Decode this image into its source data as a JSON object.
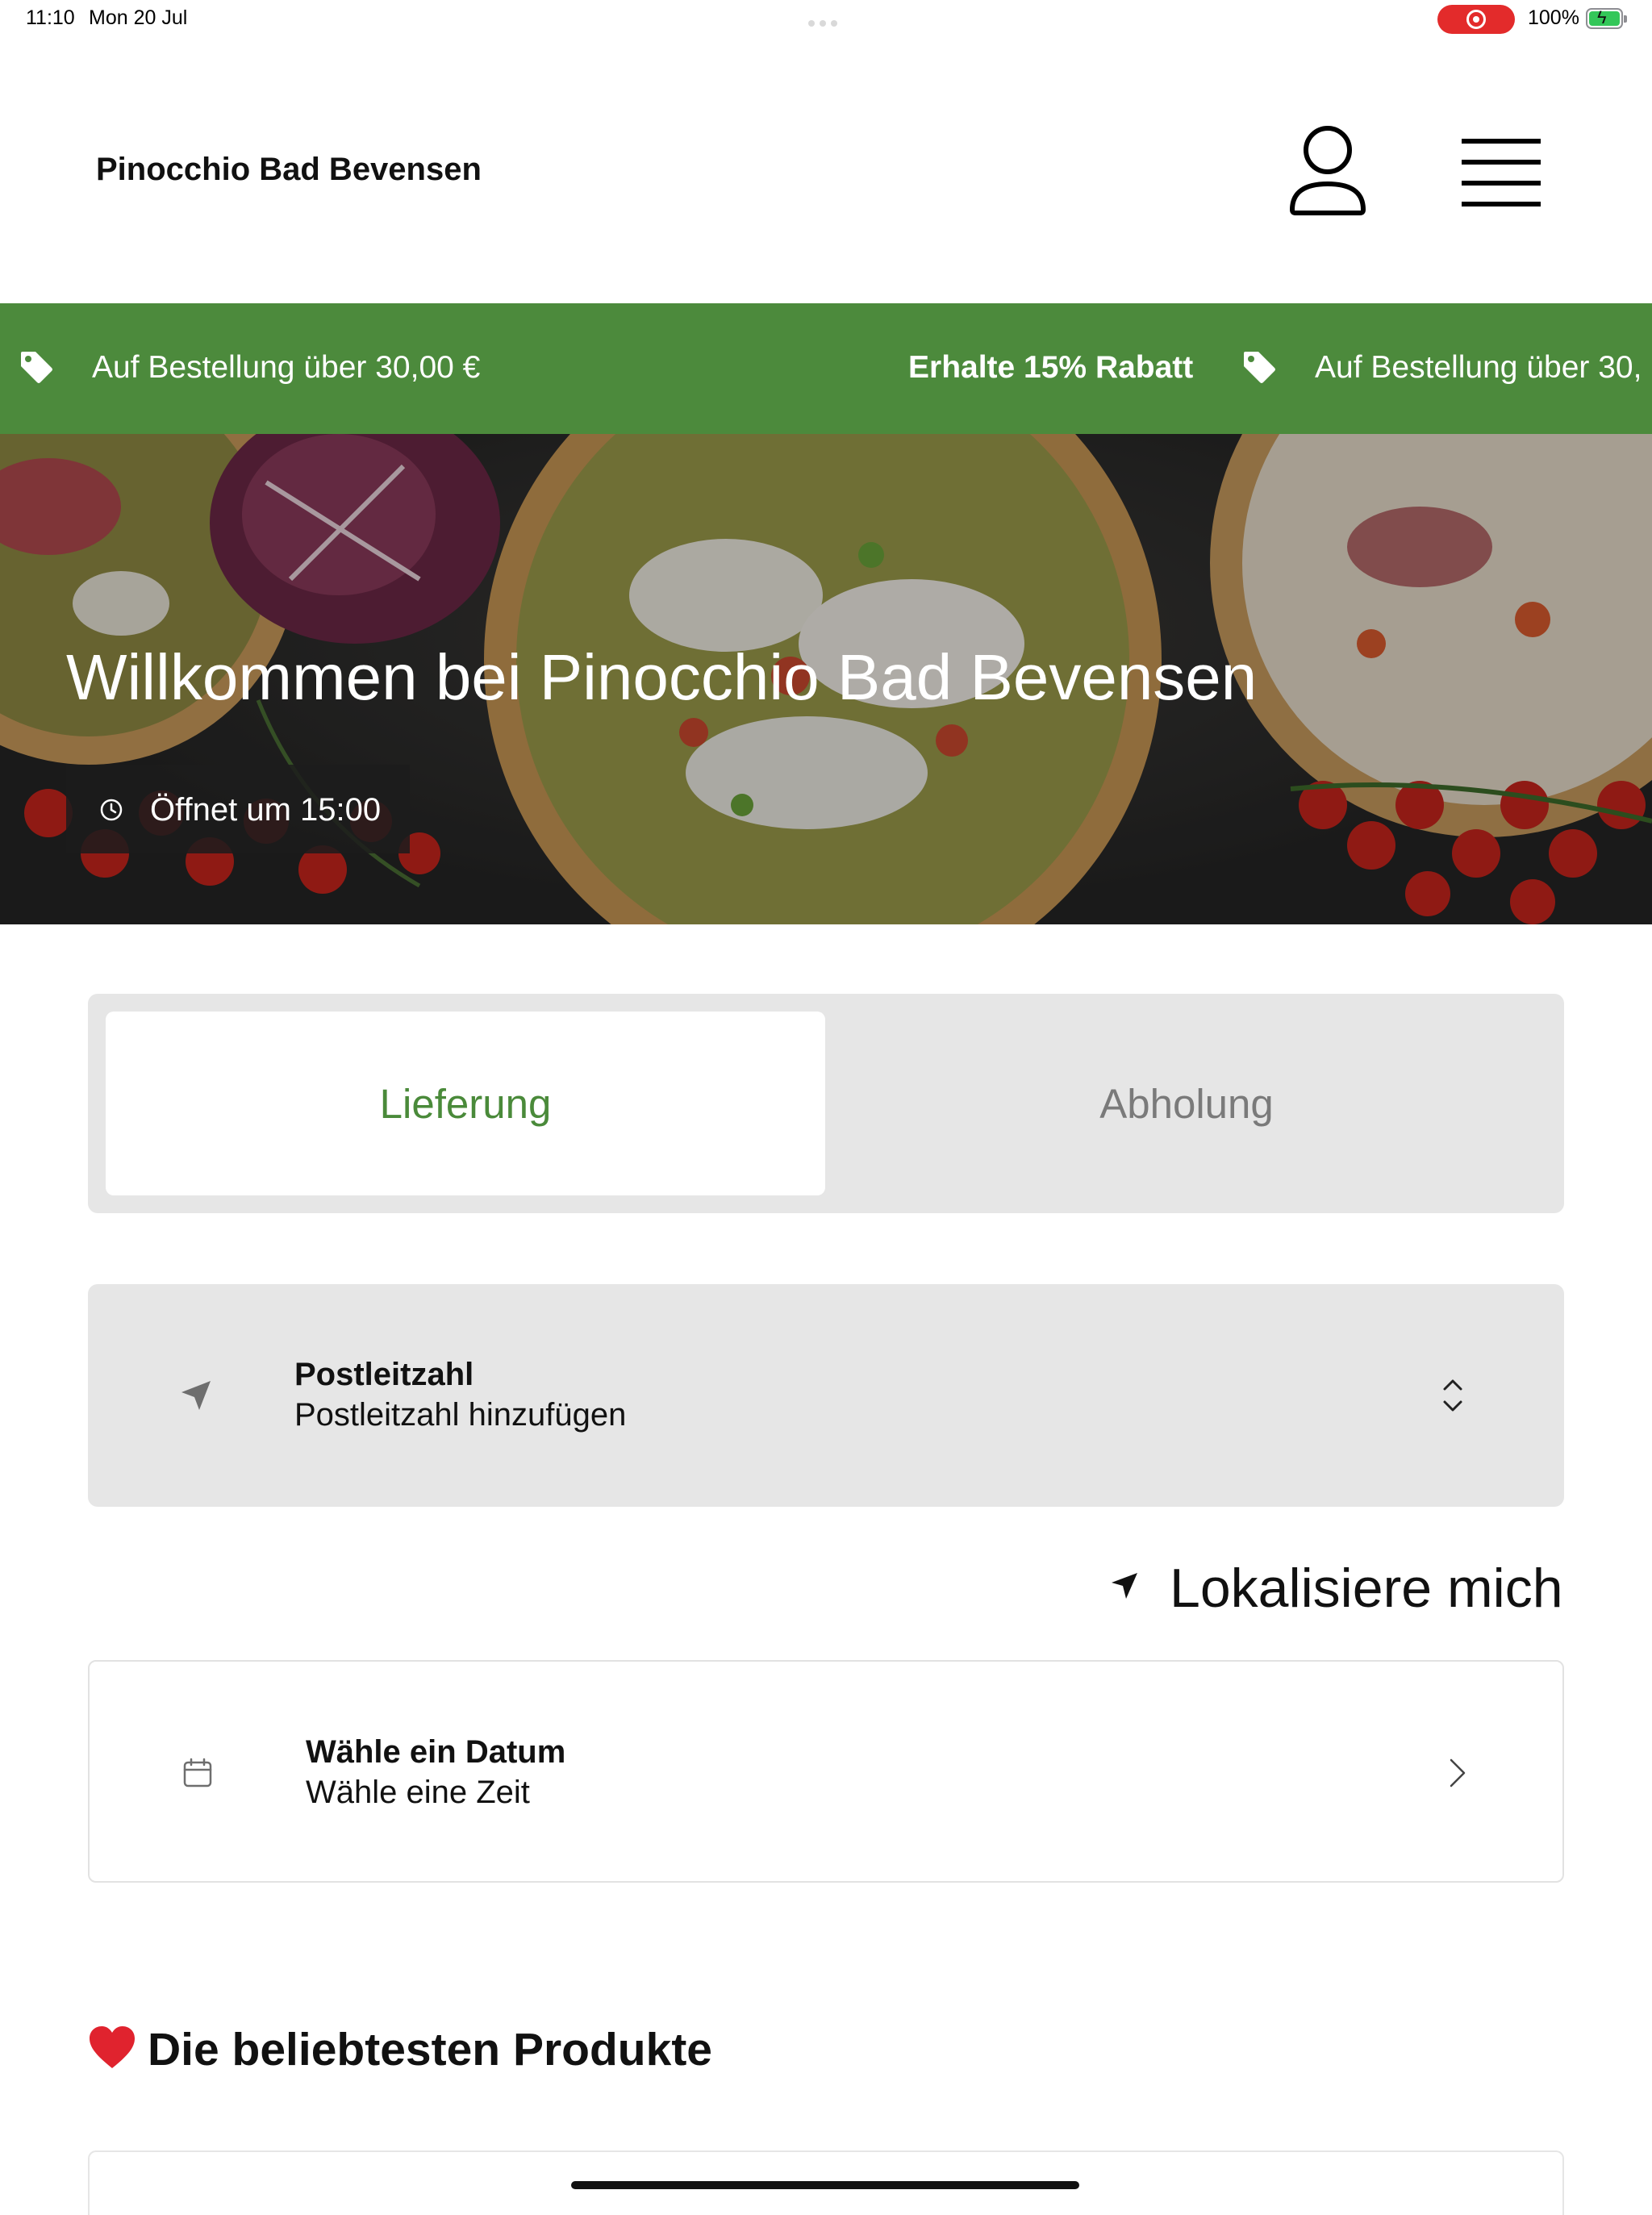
{
  "status_bar": {
    "time": "11:10",
    "date": "Mon 20 Jul",
    "battery": "100%"
  },
  "header": {
    "brand": "Pinocchio Bad Bevensen",
    "user_icon": "user-icon",
    "menu_icon": "hamburger-menu-icon"
  },
  "promo": {
    "min_order": "Auf Bestellung über 30,00 €",
    "discount": "Erhalte 15% Rabatt",
    "min_order_repeat": "Auf Bestellung über 30,",
    "icon": "tag-icon",
    "background": "#4c8a3c"
  },
  "hero": {
    "title": "Willkommen bei Pinocchio Bad Bevensen",
    "opening": "Öffnet um 15:00",
    "icon": "clock-icon"
  },
  "order_type": {
    "tabs": [
      {
        "label": "Lieferung",
        "active": true
      },
      {
        "label": "Abholung",
        "active": false
      }
    ],
    "active_color": "#4a8a3a"
  },
  "postcode": {
    "label": "Postleitzahl",
    "value": "Postleitzahl hinzufügen",
    "icon": "navigation-arrow-icon"
  },
  "locate": {
    "label": "Lokalisiere mich",
    "icon": "location-arrow-icon"
  },
  "schedule": {
    "label": "Wähle ein Datum",
    "value": "Wähle eine Zeit",
    "icon": "calendar-icon"
  },
  "popular": {
    "title": "Die beliebtesten Produkte",
    "icon": "heart-icon"
  }
}
